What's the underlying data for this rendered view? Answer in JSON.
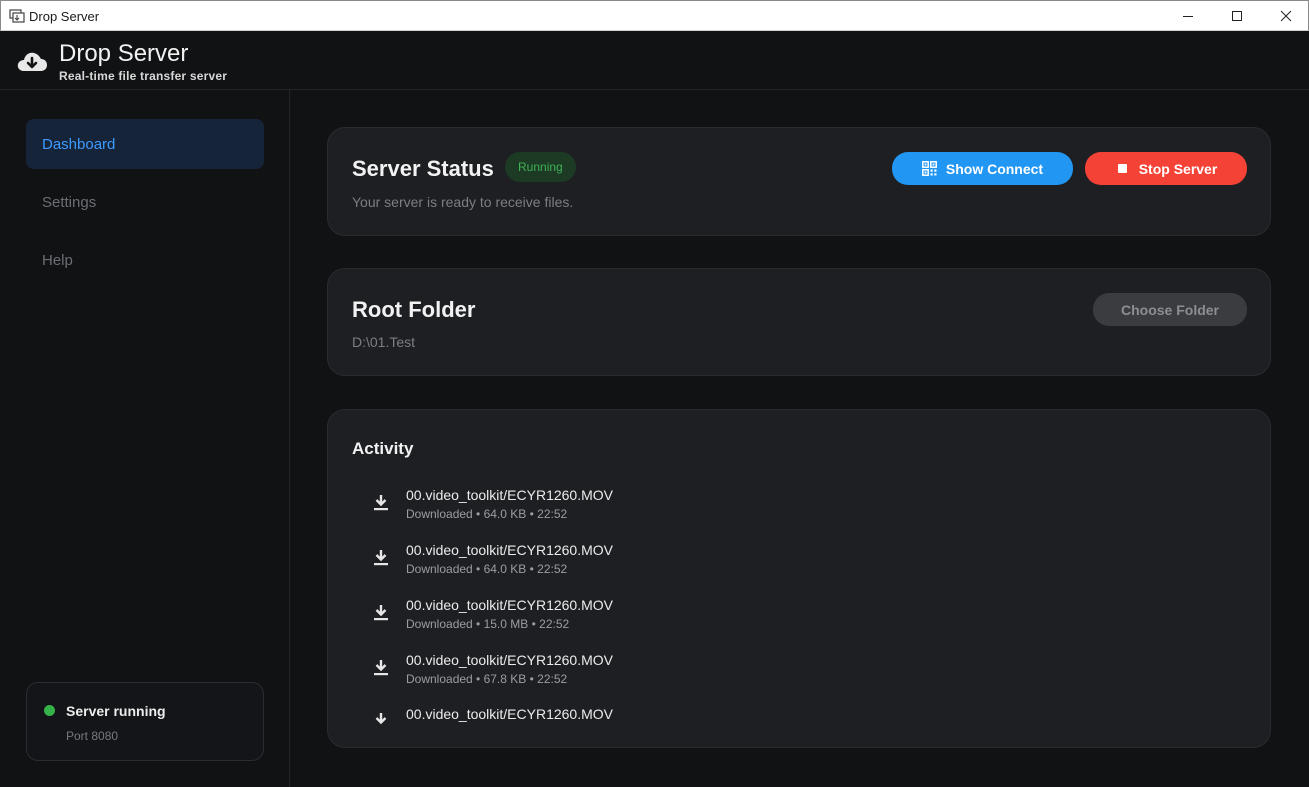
{
  "window": {
    "title": "Drop Server"
  },
  "header": {
    "app_name": "Drop Server",
    "subtitle": "Real-time file transfer server"
  },
  "sidebar": {
    "items": [
      {
        "label": "Dashboard",
        "active": true
      },
      {
        "label": "Settings",
        "active": false
      },
      {
        "label": "Help",
        "active": false
      }
    ],
    "status": {
      "title": "Server running",
      "port": "Port 8080",
      "dot_color": "#35b24a"
    }
  },
  "server_status": {
    "title": "Server Status",
    "badge": "Running",
    "subtitle": "Your server is ready to receive files.",
    "show_connect_label": "Show Connect",
    "stop_label": "Stop Server"
  },
  "root_folder": {
    "title": "Root Folder",
    "path": "D:\\01.Test",
    "choose_label": "Choose Folder"
  },
  "activity": {
    "title": "Activity",
    "items": [
      {
        "file": "00.video_toolkit/ECYR1260.MOV",
        "meta": "Downloaded • 64.0 KB • 22:52"
      },
      {
        "file": "00.video_toolkit/ECYR1260.MOV",
        "meta": "Downloaded • 64.0 KB • 22:52"
      },
      {
        "file": "00.video_toolkit/ECYR1260.MOV",
        "meta": "Downloaded • 15.0 MB • 22:52"
      },
      {
        "file": "00.video_toolkit/ECYR1260.MOV",
        "meta": "Downloaded • 67.8 KB • 22:52"
      },
      {
        "file": "00.video_toolkit/ECYR1260.MOV",
        "meta": ""
      }
    ]
  },
  "colors": {
    "accent": "#2196f3",
    "danger": "#f44336",
    "success": "#35b24a",
    "background": "#111214",
    "card": "#1e1f23"
  }
}
